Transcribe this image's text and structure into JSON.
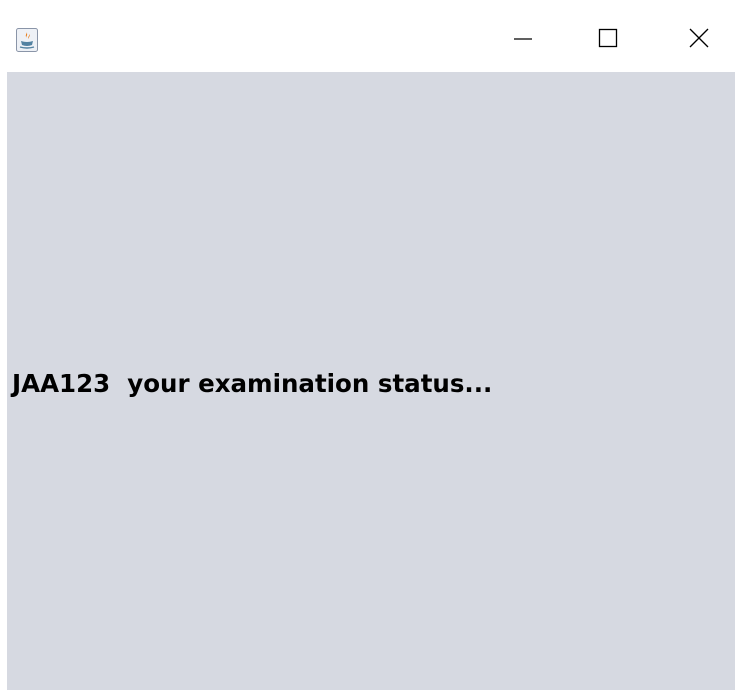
{
  "window": {
    "app_icon": "java-icon",
    "controls": {
      "minimize_icon": "minimize-icon",
      "maximize_icon": "maximize-icon",
      "close_icon": "close-icon"
    }
  },
  "content": {
    "status_text": "JAA123  your examination status...",
    "background_color": "#d6d9e1"
  }
}
